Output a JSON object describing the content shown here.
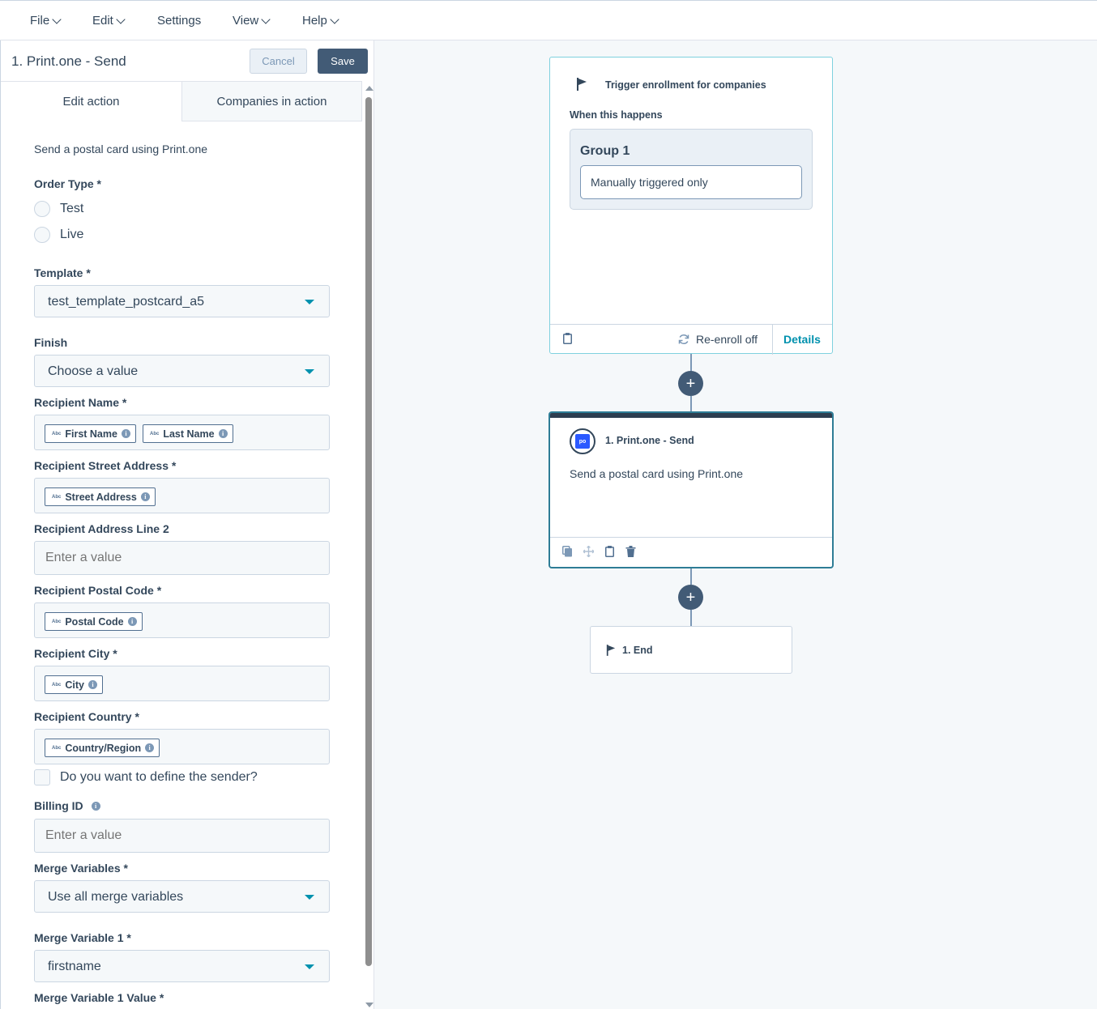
{
  "menubar": {
    "items": [
      {
        "label": "File",
        "has_chevron": true
      },
      {
        "label": "Edit",
        "has_chevron": true
      },
      {
        "label": "Settings",
        "has_chevron": false
      },
      {
        "label": "View",
        "has_chevron": true
      },
      {
        "label": "Help",
        "has_chevron": true
      }
    ]
  },
  "panel": {
    "title": "1. Print.one - Send",
    "cancel_label": "Cancel",
    "save_label": "Save",
    "tabs": [
      {
        "label": "Edit action",
        "active": true
      },
      {
        "label": "Companies in action",
        "active": false
      }
    ],
    "description": "Send a postal card using Print.one",
    "order_type": {
      "label": "Order Type *",
      "options": [
        "Test",
        "Live"
      ]
    },
    "template": {
      "label": "Template *",
      "value": "test_template_postcard_a5"
    },
    "finish": {
      "label": "Finish",
      "value": "Choose a value"
    },
    "recipient_name": {
      "label": "Recipient Name *",
      "tokens": [
        "First Name",
        "Last Name"
      ]
    },
    "recipient_street": {
      "label": "Recipient Street Address *",
      "tokens": [
        "Street Address"
      ]
    },
    "recipient_line2": {
      "label": "Recipient Address Line 2",
      "placeholder": "Enter a value"
    },
    "recipient_postal": {
      "label": "Recipient Postal Code *",
      "tokens": [
        "Postal Code"
      ]
    },
    "recipient_city": {
      "label": "Recipient City *",
      "tokens": [
        "City"
      ]
    },
    "recipient_country": {
      "label": "Recipient Country *",
      "tokens": [
        "Country/Region"
      ]
    },
    "define_sender": {
      "label": "Do you want to define the sender?",
      "checked": false
    },
    "billing_id": {
      "label": "Billing ID",
      "placeholder": "Enter a value"
    },
    "merge_variables": {
      "label": "Merge Variables *",
      "value": "Use all merge variables"
    },
    "merge_variable_1": {
      "label": "Merge Variable 1 *",
      "value": "firstname"
    },
    "merge_variable_1_value": {
      "label": "Merge Variable 1 Value *"
    },
    "token_prefix": "Abc"
  },
  "canvas": {
    "trigger": {
      "title": "Trigger enrollment for companies",
      "subtitle": "When this happens",
      "group_title": "Group 1",
      "group_rule": "Manually triggered only",
      "reenroll": "Re-enroll off",
      "details": "Details"
    },
    "action": {
      "logo_text": "po",
      "title": "1. Print.one - Send",
      "description": "Send a postal card using Print.one"
    },
    "end": {
      "title": "1. End"
    },
    "plus_symbol": "+"
  },
  "colors": {
    "primary_dark": "#425b76",
    "accent_teal": "#0091ae",
    "text": "#33475b",
    "printone_blue": "#2b59ff"
  }
}
